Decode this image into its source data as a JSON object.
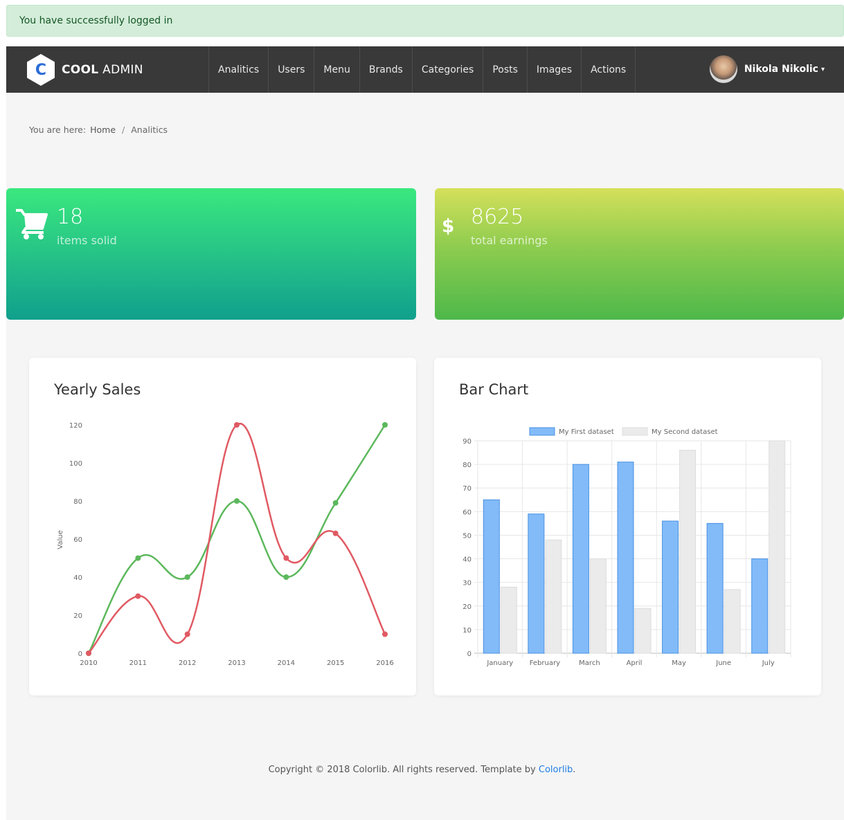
{
  "alert": {
    "message": "You have successfully logged in"
  },
  "brand": {
    "icon_letter": "C",
    "name_bold": "COOL",
    "name_regular": "ADMIN"
  },
  "nav": [
    "Analitics",
    "Users",
    "Menu",
    "Brands",
    "Categories",
    "Posts",
    "Images",
    "Actions"
  ],
  "user": {
    "name": "Nikola Nikolic"
  },
  "breadcrumb": {
    "prefix": "You are here:",
    "home": "Home",
    "separator": "/",
    "current": "Analitics"
  },
  "stats": [
    {
      "value": "18",
      "label": "items solid",
      "icon": "cart-icon"
    },
    {
      "value": "8625",
      "label": "total earnings",
      "icon": "dollar-icon"
    }
  ],
  "colors": {
    "line_green": "#5cb85c",
    "line_red": "#e05a63",
    "bar_blue": "#82bbf8",
    "bar_blue_border": "#4a90e2",
    "bar_grey": "#ebebeb",
    "bar_grey_border": "#dddddd"
  },
  "chart_data": [
    {
      "title": "Yearly Sales",
      "type": "line",
      "x": [
        "2010",
        "2011",
        "2012",
        "2013",
        "2014",
        "2015",
        "2016"
      ],
      "ylabel": "Value",
      "ylim": [
        0,
        120
      ],
      "yticks": [
        0,
        20,
        40,
        60,
        80,
        100,
        120
      ],
      "series": [
        {
          "values": [
            0,
            50,
            40,
            80,
            40,
            79,
            120
          ]
        },
        {
          "values": [
            0,
            30,
            10,
            120,
            50,
            63,
            10
          ]
        }
      ],
      "grid": false
    },
    {
      "title": "Bar Chart",
      "type": "bar",
      "categories": [
        "January",
        "February",
        "March",
        "April",
        "May",
        "June",
        "July"
      ],
      "ylim": [
        0,
        90
      ],
      "yticks": [
        0,
        10,
        20,
        30,
        40,
        50,
        60,
        70,
        80,
        90
      ],
      "series": [
        {
          "name": "My First dataset",
          "values": [
            65,
            59,
            80,
            81,
            56,
            55,
            40
          ]
        },
        {
          "name": "My Second dataset",
          "values": [
            28,
            48,
            40,
            19,
            86,
            27,
            90
          ]
        }
      ],
      "legend": "top",
      "grid": true
    }
  ],
  "footer": {
    "text": "Copyright © 2018 Colorlib. All rights reserved. Template by",
    "link": "Colorlib",
    "end": "."
  }
}
